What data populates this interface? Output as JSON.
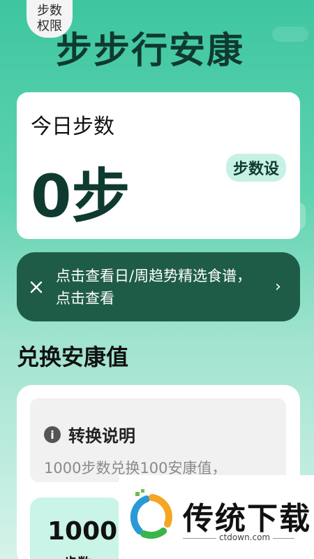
{
  "header": {
    "permission_line1": "步数",
    "permission_line2": "权限",
    "title": "步步行安康"
  },
  "today": {
    "label": "今日步数",
    "value": "0步",
    "set_button": "步数设"
  },
  "float_button": {
    "label": "···"
  },
  "recipe_banner": {
    "icon": "utensils-icon",
    "text": "点击查看日/周趋势精选食谱，点击查看",
    "arrow": "›"
  },
  "exchange": {
    "section_title": "兑换安康值",
    "explain_title": "转换说明",
    "explain_desc": "1000步数兑换100安康值，",
    "option_value": "1000",
    "option_unit": "步数"
  },
  "watermark": {
    "title": "传统下载",
    "url": "ctdown.com"
  },
  "colors": {
    "accent_dark": "#1f5c47",
    "accent_light": "#c7f1e4",
    "bg_top": "#3ec6a0"
  }
}
